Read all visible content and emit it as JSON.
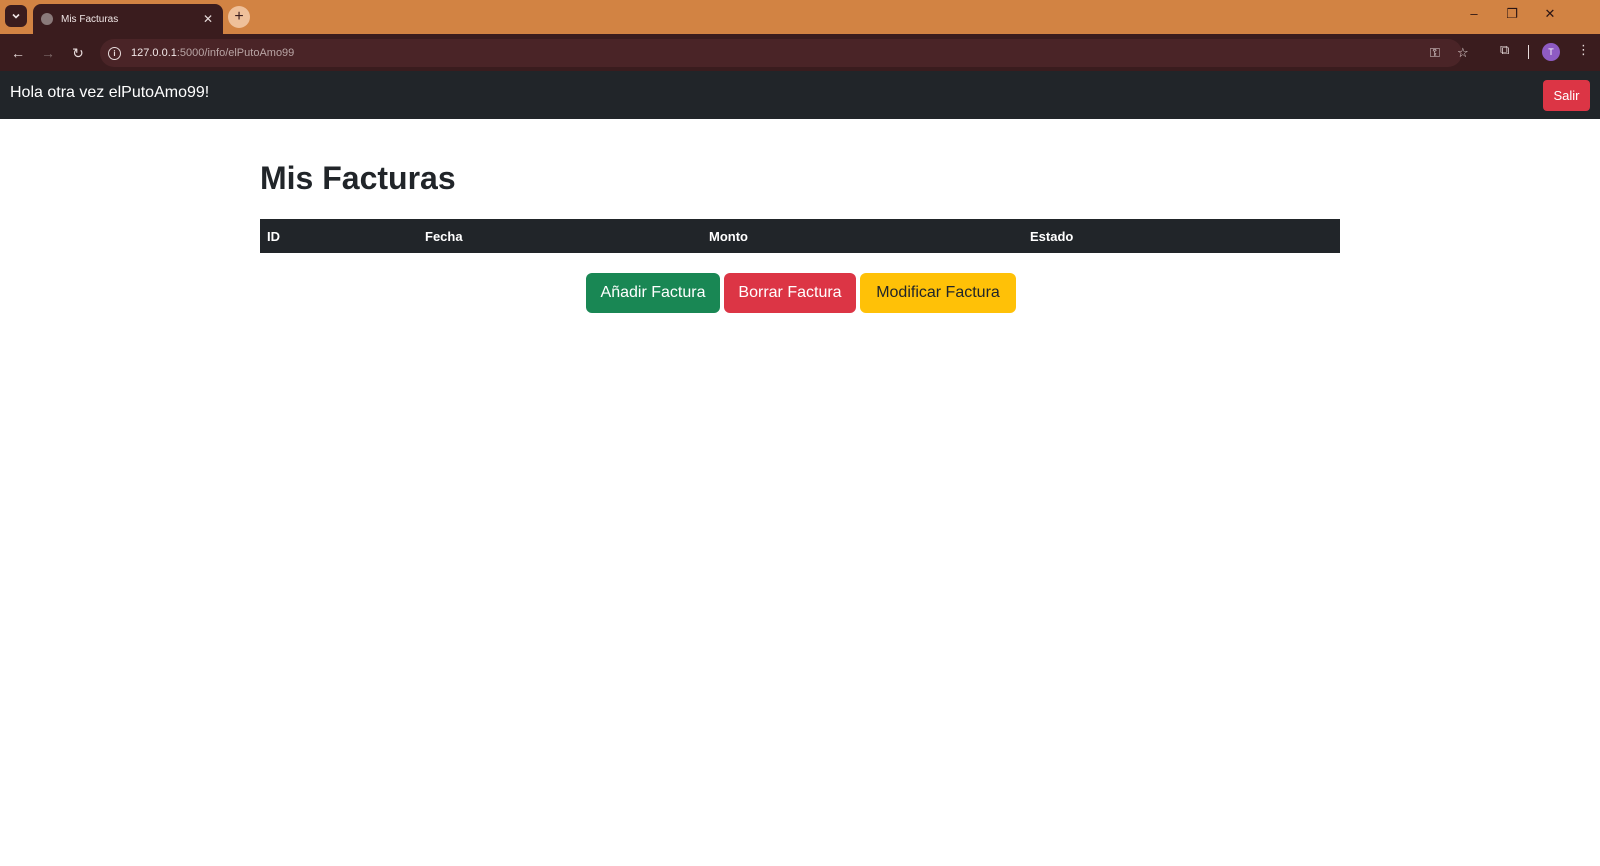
{
  "browser": {
    "tab_title": "Mis Facturas",
    "url_host": "127.0.0.1",
    "url_path": ":5000/info/elPutoAmo99",
    "profile_initial": "T",
    "colors": {
      "tabbar": "#d28343",
      "toolbar": "#3a1c1e"
    }
  },
  "navbar": {
    "greeting": "Hola otra vez elPutoAmo99!",
    "logout_label": "Salir"
  },
  "main": {
    "title": "Mis Facturas",
    "table": {
      "columns": [
        "ID",
        "Fecha",
        "Monto",
        "Estado"
      ],
      "rows": []
    },
    "buttons": {
      "add": "Añadir Factura",
      "delete": "Borrar Factura",
      "edit": "Modificar Factura"
    }
  },
  "colors": {
    "success": "#198754",
    "danger": "#dc3545",
    "warning": "#ffc107",
    "dark": "#212529"
  }
}
